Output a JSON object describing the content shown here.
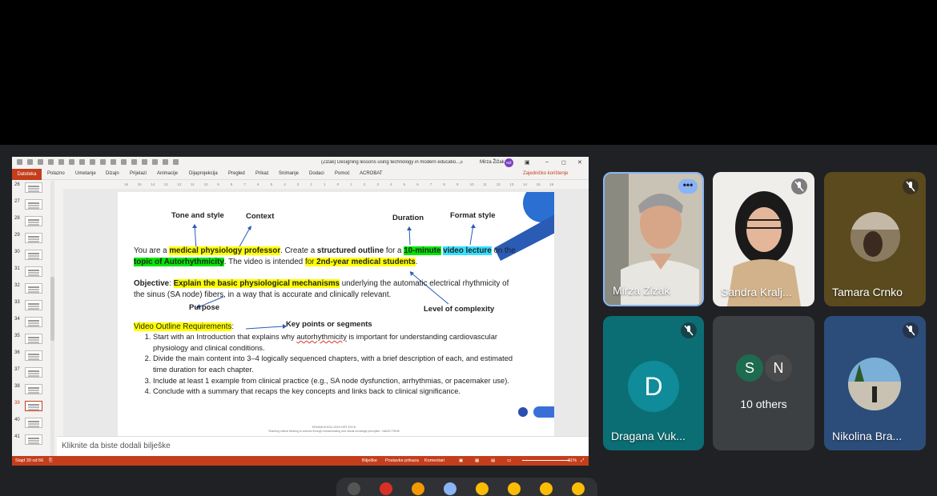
{
  "ppt": {
    "doc_title": "(Zizak) Designing lessons using technology in modern educatio...",
    "user_name": "Mirza Žižak",
    "user_initials": "MŽ",
    "ribbon_tabs": [
      "Datoteka",
      "Polazno",
      "Umetanje",
      "Dizajn",
      "Prijelazi",
      "Animacije",
      "Dijaprojekcija",
      "Pregled",
      "Prikaz",
      "Snimanje",
      "Dodaci",
      "Pomoć",
      "ACROBAT"
    ],
    "share_label": "Zajedničko korištenje",
    "ruler_marks": [
      "16",
      "15",
      "14",
      "13",
      "12",
      "11",
      "10",
      "9",
      "8",
      "7",
      "6",
      "5",
      "4",
      "3",
      "2",
      "1",
      "0",
      "1",
      "2",
      "3",
      "4",
      "5",
      "6",
      "7",
      "8",
      "9",
      "10",
      "11",
      "12",
      "13",
      "14",
      "15",
      "16"
    ],
    "thumb_numbers": [
      "26",
      "27",
      "28",
      "29",
      "30",
      "31",
      "32",
      "33",
      "34",
      "35",
      "36",
      "37",
      "38",
      "39",
      "40",
      "41"
    ],
    "selected_slide": "39",
    "notes_placeholder": "Kliknite da biste dodali bilješke",
    "status_slide": "Slajd 39 od 66",
    "status_notes": "Bilješke",
    "status_display": "Postavke prikaza",
    "status_comments": "Komentari",
    "zoom": "91%"
  },
  "slide": {
    "ann_tone": "Tone and style",
    "ann_context": "Context",
    "ann_duration": "Duration",
    "ann_format": "Format style",
    "ann_purpose": "Purpose",
    "ann_complexity": "Level of complexity",
    "ann_keypoints": "Key points or segments",
    "p1_a": "You are a ",
    "p1_b": "medical physiology professor",
    "p1_c": ". Create a ",
    "p1_d": "structured outline",
    "p1_e": " for a ",
    "p1_f": "10-minute",
    "p1_g": " ",
    "p1_h": "video lecture",
    "p1_i": " on the ",
    "p1_j": "topic of Autorhythmicity",
    "p1_k": ". The video is intended ",
    "p1_l": "for ",
    "p1_m": "2nd-year medical students",
    "p1_n": ".",
    "obj_label": "Objective",
    "obj_colon": ":  ",
    "obj_hl": "Explain the basic physiological mechanisms",
    "obj_rest": " underlying the automatic electrical rhythmicity of the sinus (SA node) fibers, in a way that is accurate and clinically relevant.",
    "req_label": "Video Outline Requirements",
    "req_colon": ":",
    "li1_a": "Start with an Introduction that explains why ",
    "li1_b": "autorhythmicity",
    "li1_c": " is important for understanding cardiovascular physiology and clinical conditions.",
    "li2": "Divide the main content into 3–4 logically sequenced chapters, with a brief description of each, and estimated time duration for each chapter.",
    "li3": "Include at least 1 example from clinical practice (e.g., SA node dysfunction, arrhythmias, or pacemaker use).",
    "li4": "Conclude with a summary that recaps the key concepts and links back to clinical significance.",
    "footer_1": "ERASMUS-EDU-2023-VIRT-EXCH",
    "footer_2": "Teaching critical thinking to science through newsbranding and virtual exchange principles - NANO-THINK"
  },
  "participants": [
    {
      "name": "Mirza Zizak",
      "muted": false
    },
    {
      "name": "Sandra Kralj...",
      "muted": true
    },
    {
      "name": "Tamara Crnko",
      "muted": true
    },
    {
      "name": "Dragana Vuk...",
      "muted": true,
      "initial": "D"
    },
    {
      "name": "10 others",
      "initials": [
        "S",
        "N"
      ]
    },
    {
      "name": "Nikolina Bra...",
      "muted": true
    }
  ],
  "colors": {
    "ppt_accent": "#c43e1c",
    "tile_dragana": "#0b6e74",
    "avatar_d": "#0f8b9a",
    "avatar_s": "#1e6b4f",
    "avatar_n": "#4a4a4a",
    "tile_nikolina": "#2c4d7a"
  },
  "icons": [
    "more-options-icon",
    "mic-off-icon",
    "search-icon"
  ]
}
